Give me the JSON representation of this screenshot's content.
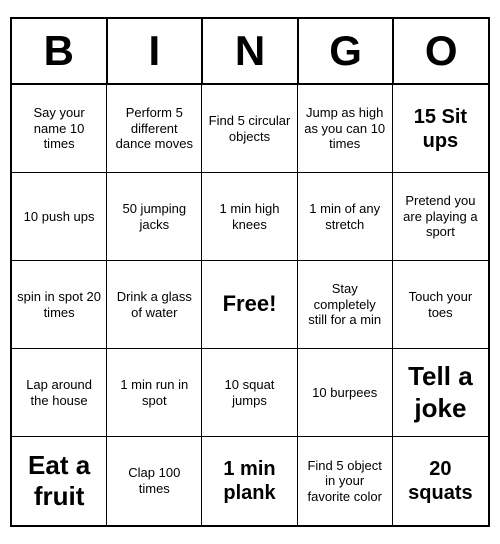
{
  "header": {
    "letters": [
      "B",
      "I",
      "N",
      "G",
      "O"
    ]
  },
  "cells": [
    {
      "text": "Say your name 10 times",
      "style": "normal"
    },
    {
      "text": "Perform 5 different dance moves",
      "style": "normal"
    },
    {
      "text": "Find 5 circular objects",
      "style": "normal"
    },
    {
      "text": "Jump as high as you can 10 times",
      "style": "normal"
    },
    {
      "text": "15 Sit ups",
      "style": "large"
    },
    {
      "text": "10 push ups",
      "style": "normal"
    },
    {
      "text": "50 jumping jacks",
      "style": "normal"
    },
    {
      "text": "1 min high knees",
      "style": "normal"
    },
    {
      "text": "1 min of any stretch",
      "style": "normal"
    },
    {
      "text": "Pretend you are playing a sport",
      "style": "normal"
    },
    {
      "text": "spin in spot 20 times",
      "style": "normal"
    },
    {
      "text": "Drink a glass of water",
      "style": "normal"
    },
    {
      "text": "Free!",
      "style": "free"
    },
    {
      "text": "Stay completely still for a min",
      "style": "normal"
    },
    {
      "text": "Touch your toes",
      "style": "normal"
    },
    {
      "text": "Lap around the house",
      "style": "normal"
    },
    {
      "text": "1 min run in spot",
      "style": "normal"
    },
    {
      "text": "10 squat jumps",
      "style": "normal"
    },
    {
      "text": "10 burpees",
      "style": "normal"
    },
    {
      "text": "Tell a joke",
      "style": "xlarge"
    },
    {
      "text": "Eat a fruit",
      "style": "xlarge"
    },
    {
      "text": "Clap 100 times",
      "style": "normal"
    },
    {
      "text": "1 min plank",
      "style": "large"
    },
    {
      "text": "Find 5 object in your favorite color",
      "style": "small"
    },
    {
      "text": "20 squats",
      "style": "large"
    }
  ]
}
